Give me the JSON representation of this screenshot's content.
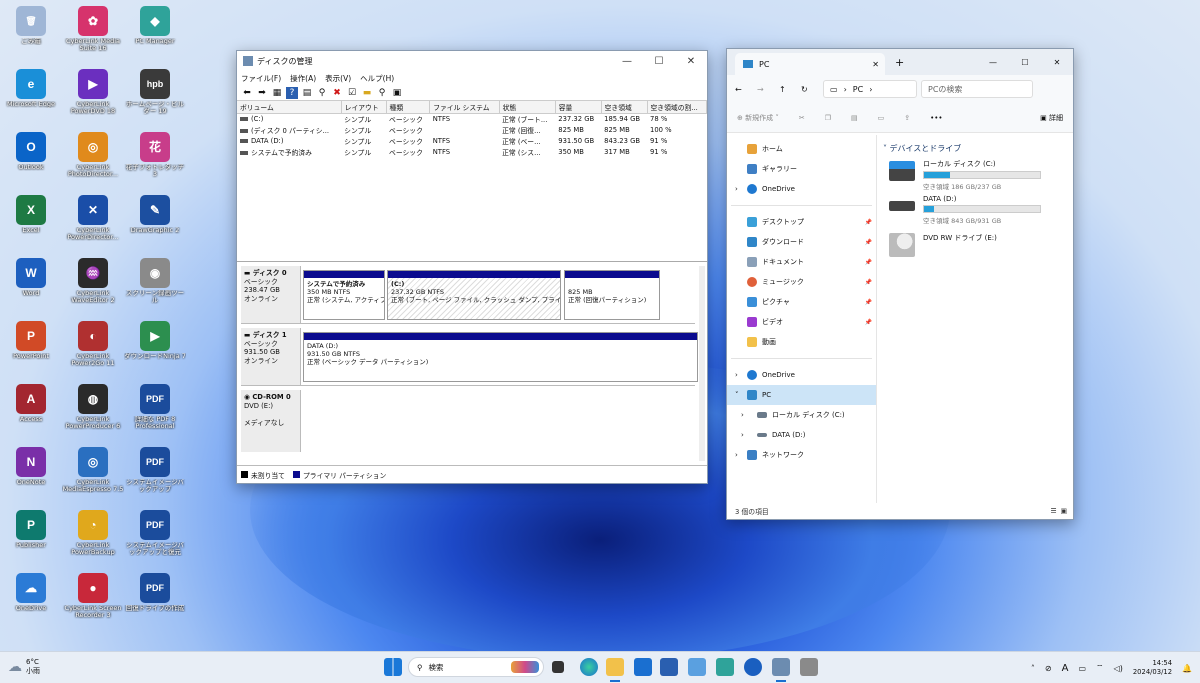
{
  "desktop": {
    "icons": [
      {
        "label": "ごみ箱",
        "glyph": "🗑",
        "color": "#9fb6d6"
      },
      {
        "label": "CyberLink Media Suite 16",
        "glyph": "✿",
        "color": "#d6336c"
      },
      {
        "label": "PC Manager",
        "glyph": "◆",
        "color": "#2fa39a"
      },
      {
        "label": "Microsoft Edge",
        "glyph": "e",
        "color": "#1a8fd8"
      },
      {
        "label": "CyberLink PowerDVD 18",
        "glyph": "▶",
        "color": "#6b2fbf"
      },
      {
        "label": "ホームページ・ビルダー 19",
        "glyph": "hpb",
        "color": "#3a3a3a"
      },
      {
        "label": "Outlook",
        "glyph": "O",
        "color": "#0a64c8"
      },
      {
        "label": "CyberLink PhotoDirector...",
        "glyph": "◎",
        "color": "#e08a1c"
      },
      {
        "label": "花子フォトレタッチ 3",
        "glyph": "花",
        "color": "#c83d8a"
      },
      {
        "label": "Excel",
        "glyph": "X",
        "color": "#1e7a44"
      },
      {
        "label": "CyberLink PowerDirector...",
        "glyph": "✕",
        "color": "#1a4ea8"
      },
      {
        "label": "DrawGraphic 2",
        "glyph": "✎",
        "color": "#1c4fa0"
      },
      {
        "label": "Word",
        "glyph": "W",
        "color": "#1d5fbf"
      },
      {
        "label": "CyberLink WaveEditor 2",
        "glyph": "♒",
        "color": "#2b2b2b"
      },
      {
        "label": "スクリーン録画ツール",
        "glyph": "◉",
        "color": "#8a8a8a"
      },
      {
        "label": "PowerPoint",
        "glyph": "P",
        "color": "#d14a26"
      },
      {
        "label": "CyberLink Power2Go 11",
        "glyph": "◐",
        "color": "#b03030"
      },
      {
        "label": "ダウンロードNinja 7",
        "glyph": "▶",
        "color": "#2c8f4f"
      },
      {
        "label": "Access",
        "glyph": "A",
        "color": "#a32630"
      },
      {
        "label": "CyberLink PowerProducer 6",
        "glyph": "◍",
        "color": "#2a2a2a"
      },
      {
        "label": "詳細な PDF 8 Professional",
        "glyph": "PDF",
        "color": "#1b4c9c"
      },
      {
        "label": "OneNote",
        "glyph": "N",
        "color": "#7a2fa8"
      },
      {
        "label": "CyberLink MediaEspresso 7.5",
        "glyph": "◎",
        "color": "#2a6fc0"
      },
      {
        "label": "システムイメージバックアップ",
        "glyph": "PDF",
        "color": "#1b4c9c"
      },
      {
        "label": "Publisher",
        "glyph": "P",
        "color": "#0e7a6e"
      },
      {
        "label": "CyberLink PowerBackup",
        "glyph": "◔",
        "color": "#e0a81c"
      },
      {
        "label": "システムイメージバックアップと復元",
        "glyph": "PDF",
        "color": "#1b4c9c"
      },
      {
        "label": "OneDrive",
        "glyph": "☁",
        "color": "#2b7bd6"
      },
      {
        "label": "CyberLink Screen Recorder 3",
        "glyph": "●",
        "color": "#c8283a"
      },
      {
        "label": "回復ドライブの作成",
        "glyph": "PDF",
        "color": "#1b4c9c"
      }
    ]
  },
  "diskmgmt": {
    "title": "ディスクの管理",
    "menu": [
      "ファイル(F)",
      "操作(A)",
      "表示(V)",
      "ヘルプ(H)"
    ],
    "columns": [
      "ボリューム",
      "レイアウト",
      "種類",
      "ファイル システム",
      "状態",
      "容量",
      "空き領域",
      "空き領域の割..."
    ],
    "rows": [
      [
        "(C:)",
        "シンプル",
        "ベーシック",
        "NTFS",
        "正常 (ブート...",
        "237.32 GB",
        "185.94 GB",
        "78 %"
      ],
      [
        "(ディスク 0 パーティシ...",
        "シンプル",
        "ベーシック",
        "",
        "正常 (回復...",
        "825 MB",
        "825 MB",
        "100 %"
      ],
      [
        "DATA (D:)",
        "シンプル",
        "ベーシック",
        "NTFS",
        "正常 (ベー...",
        "931.50 GB",
        "843.23 GB",
        "91 %"
      ],
      [
        "システムで予約済み",
        "シンプル",
        "ベーシック",
        "NTFS",
        "正常 (シス...",
        "350 MB",
        "317 MB",
        "91 %"
      ]
    ],
    "disk0": {
      "name": "ディスク 0",
      "type": "ベーシック",
      "size": "238.47 GB",
      "status": "オンライン",
      "p1": {
        "l1": "システムで予約済み",
        "l2": "350 MB NTFS",
        "l3": "正常 (システム, アクティブ"
      },
      "p2": {
        "l1": "(C:)",
        "l2": "237.32 GB NTFS",
        "l3": "正常 (ブート, ページ ファイル, クラッシュ ダンプ, プライマリ パ"
      },
      "p3": {
        "l1": "",
        "l2": "825 MB",
        "l3": "正常 (回復パーティション)"
      }
    },
    "disk1": {
      "name": "ディスク 1",
      "type": "ベーシック",
      "size": "931.50 GB",
      "status": "オンライン",
      "p1": {
        "l1": "DATA  (D:)",
        "l2": "931.50 GB NTFS",
        "l3": "正常 (ベーシック データ パーティション)"
      }
    },
    "cdrom": {
      "name": "CD-ROM 0",
      "type": "DVD (E:)",
      "status": "メディアなし"
    },
    "legend": {
      "unalloc": "未割り当て",
      "primary": "プライマリ パーティション"
    }
  },
  "explorer": {
    "tab": "PC",
    "address_root": "PC",
    "search_placeholder": "PCの検索",
    "new_label": "新規作成",
    "details_label": "詳細",
    "nav": {
      "home": "ホーム",
      "gallery": "ギャラリー",
      "onedrive": "OneDrive",
      "desktop": "デスクトップ",
      "downloads": "ダウンロード",
      "documents": "ドキュメント",
      "music": "ミュージック",
      "pictures": "ピクチャ",
      "videos": "ビデオ",
      "movies": "動画",
      "onedrive2": "OneDrive",
      "pc": "PC",
      "local_c": "ローカル ディスク (C:)",
      "data_d": "DATA (D:)",
      "network": "ネットワーク"
    },
    "section": "デバイスとドライブ",
    "drives": [
      {
        "name": "ローカル ディスク (C:)",
        "free": "空き領域 186 GB/237 GB",
        "used_fraction": 0.22
      },
      {
        "name": "DATA (D:)",
        "free": "空き領域 843 GB/931 GB",
        "used_fraction": 0.09
      },
      {
        "name": "DVD RW ドライブ (E:)",
        "free": "",
        "used_fraction": 0
      }
    ],
    "status": "3 個の項目"
  },
  "taskbar": {
    "weather_temp": "6°C",
    "weather_desc": "小雨",
    "search": "検索",
    "time": "14:54",
    "date": "2024/03/12",
    "ime": "A"
  }
}
